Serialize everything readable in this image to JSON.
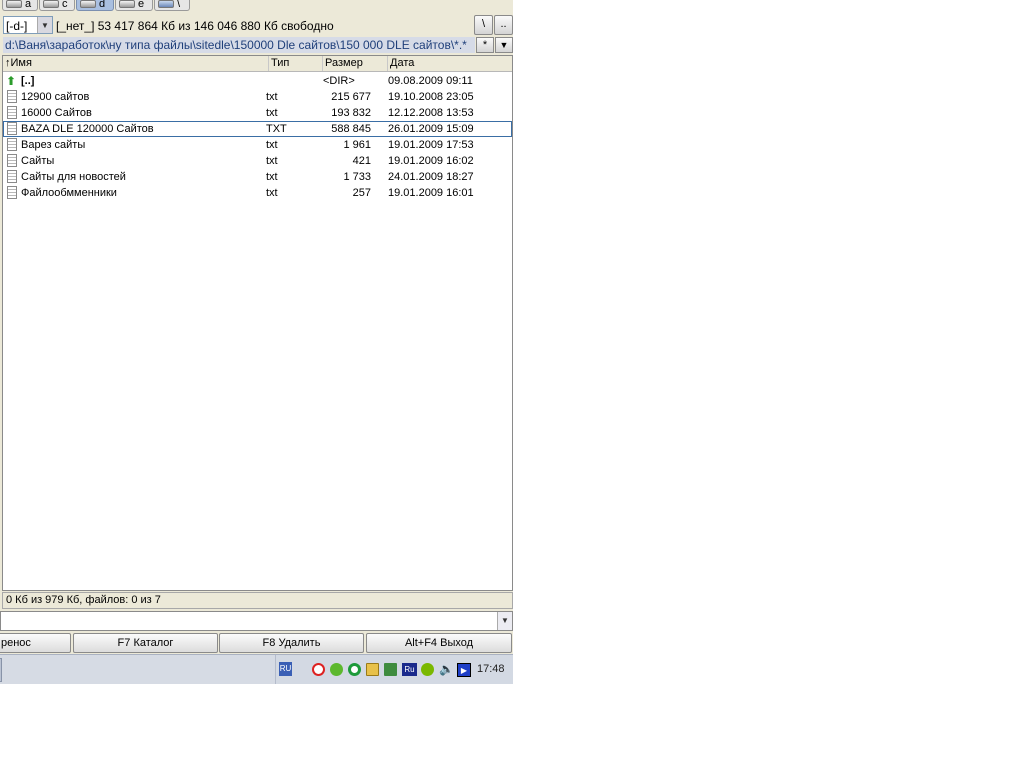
{
  "drives": [
    {
      "letter": "a",
      "active": false
    },
    {
      "letter": "c",
      "active": false
    },
    {
      "letter": "d",
      "active": true
    },
    {
      "letter": "e",
      "active": false
    },
    {
      "letter": "\\",
      "active": false
    }
  ],
  "drive_selector": {
    "value": "[-d-]"
  },
  "free_space": "[_нет_]  53 417 864 Кб из 146 046 880 Кб свободно",
  "root_btn": "\\",
  "up_btn": "..",
  "path": "d:\\Ваня\\заработок\\ну типа файлы\\sitedle\\150000 Dle сайтов\\150 000 DLE сайтов\\*.*",
  "path_star": "*",
  "columns": {
    "name": "↑Имя",
    "type": "Тип",
    "size": "Размер",
    "date": "Дата"
  },
  "files": [
    {
      "name": "[..]",
      "type": "",
      "size": "<DIR>",
      "date": "09.08.2009 09:11",
      "is_up": true
    },
    {
      "name": "12900 сайтов",
      "type": "txt",
      "size": "215 677",
      "date": "19.10.2008 23:05"
    },
    {
      "name": "16000 Сайтов",
      "type": "txt",
      "size": "193 832",
      "date": "12.12.2008 13:53"
    },
    {
      "name": "BAZA DLE 120000 Сайтов",
      "type": "TXT",
      "size": "588 845",
      "date": "26.01.2009 15:09",
      "selected": true
    },
    {
      "name": "Варез сайты",
      "type": "txt",
      "size": "1 961",
      "date": "19.01.2009 17:53"
    },
    {
      "name": "Сайты",
      "type": "txt",
      "size": "421",
      "date": "19.01.2009 16:02"
    },
    {
      "name": "Сайты для новостей",
      "type": "txt",
      "size": "1 733",
      "date": "24.01.2009 18:27"
    },
    {
      "name": "Файлообмменники",
      "type": "txt",
      "size": "257",
      "date": "19.01.2009 16:01"
    }
  ],
  "status": "0 Кб из 979 Кб, файлов: 0 из 7",
  "fkeys": [
    "ренос",
    "F7 Каталог",
    "F8 Удалить",
    "Alt+F4 Выход"
  ],
  "taskbar": {
    "lang": "RU",
    "tray_lang": "Ru",
    "clock": "17:48",
    "icons": [
      "opera-icon",
      "green-flower-icon",
      "green-circle-icon",
      "envelope-icon",
      "network-icon",
      "lang-indicator",
      "nvidia-icon",
      "volume-icon",
      "media-player-icon"
    ]
  }
}
